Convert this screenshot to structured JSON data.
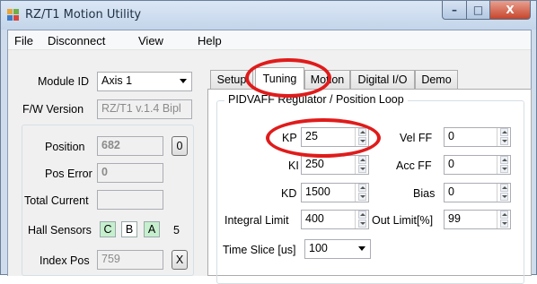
{
  "window": {
    "title": "RZ/T1 Motion Utility",
    "minimize": "–",
    "maximize": "□",
    "close": "X"
  },
  "colors": {
    "annotation": "#e01b1b",
    "hall_green": "#c6efce",
    "title_bg": "#cfdcec"
  },
  "menu": {
    "file": "File",
    "disconnect": "Disconnect",
    "view": "View",
    "help": "Help"
  },
  "left": {
    "module_id_label": "Module ID",
    "module_id_value": "Axis 1",
    "fw_label": "F/W Version",
    "fw_value": "RZ/T1 v.1.4 Bipl",
    "position_label": "Position",
    "position_value": "682",
    "position_reset": "0",
    "pos_error_label": "Pos Error",
    "pos_error_value": "0",
    "total_current_label": "Total Current",
    "total_current_value": "",
    "hall_label": "Hall Sensors",
    "hall": [
      "C",
      "B",
      "A"
    ],
    "hall_count": "5",
    "index_label": "Index Pos",
    "index_value": "759",
    "index_clear": "X"
  },
  "tabs": [
    "Setup",
    "Tuning",
    "Motion",
    "Digital I/O",
    "Demo"
  ],
  "tuning": {
    "group_title": "PIDVAFF Regulator / Position Loop",
    "kp_label": "KP",
    "kp": "25",
    "ki_label": "KI",
    "ki": "250",
    "kd_label": "KD",
    "kd": "1500",
    "ilimit_label": "Integral Limit",
    "ilimit": "400",
    "velff_label": "Vel FF",
    "velff": "0",
    "accff_label": "Acc FF",
    "accff": "0",
    "bias_label": "Bias",
    "bias": "0",
    "outlimit_label": "Out Limit[%]",
    "outlimit": "99",
    "timeslice_label": "Time Slice [us]",
    "timeslice": "100"
  }
}
